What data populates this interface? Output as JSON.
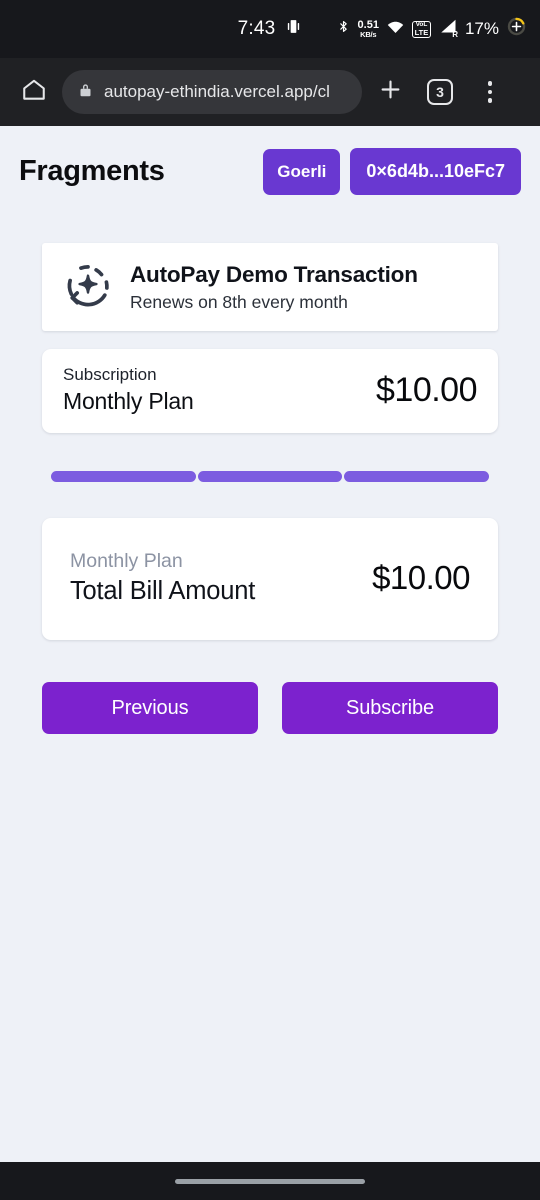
{
  "status_bar": {
    "time": "7:43",
    "cast_icon": "screen-cast-icon",
    "bluetooth_icon": "bluetooth-icon",
    "network_speed_value": "0.51",
    "network_speed_unit": "KB/s",
    "wifi_icon": "wifi-icon",
    "volte_top": "VoLTE",
    "volte_line1": "VoL",
    "volte_line2": "LTE",
    "signal_icon": "signal-bars-icon",
    "signal_roaming": "R",
    "battery_percent": "17%",
    "battery_icon": "battery-charging-icon"
  },
  "browser": {
    "home_icon": "home-icon",
    "lock_icon": "lock-icon",
    "url": "autopay-ethindia.vercel.app/cl",
    "new_tab_icon": "plus-icon",
    "tab_count": "3",
    "menu_icon": "more-vertical-icon"
  },
  "app": {
    "title": "Fragments",
    "network_badge": "Goerli",
    "wallet_badge": "0×6d4b...10eFc7"
  },
  "transaction": {
    "icon": "auto-renew-sparkle-icon",
    "title": "AutoPay Demo Transaction",
    "subtitle": "Renews on 8th every month"
  },
  "subscription": {
    "label": "Subscription",
    "plan": "Monthly Plan",
    "price": "$10.00"
  },
  "stepper": {
    "steps": [
      {
        "index": 1,
        "state": "complete"
      },
      {
        "index": 2,
        "state": "complete"
      },
      {
        "index": 3,
        "state": "complete"
      }
    ]
  },
  "total": {
    "plan": "Monthly Plan",
    "label": "Total Bill Amount",
    "price": "$10.00"
  },
  "actions": {
    "previous_label": "Previous",
    "subscribe_label": "Subscribe"
  },
  "colors": {
    "page_background": "#eef1f7",
    "badge_purple": "#6938d1",
    "button_purple": "#7c22ce",
    "stepper_purple": "#7c5ce0",
    "card_white": "#ffffff",
    "chrome_dark": "#202124",
    "status_dark": "#17181c"
  }
}
